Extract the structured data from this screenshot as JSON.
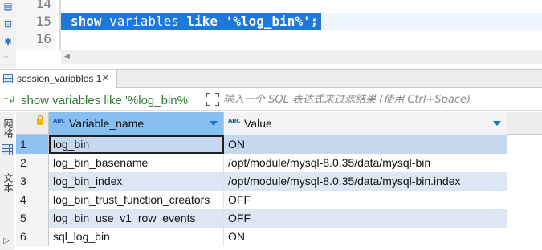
{
  "editor": {
    "line_numbers": [
      "14",
      "15",
      "16"
    ],
    "code_parts": [
      "show",
      " variables ",
      "like",
      " '%log_bin%';"
    ]
  },
  "result_tabs": [
    {
      "label": "session_variables 1",
      "close": "×"
    }
  ],
  "filter": {
    "query_text": "show variables like '%log_bin%'",
    "placeholder": "输入一个 SQL 表达式来过滤结果 (使用 Ctrl+Space)"
  },
  "side_panel": {
    "grid_label": "网格",
    "text_label": "文本"
  },
  "grid": {
    "type_badge": "ABC",
    "columns": [
      {
        "name": "Variable_name"
      },
      {
        "name": "Value"
      }
    ],
    "rows": [
      {
        "num": "1",
        "variable_name": "log_bin",
        "value": "ON"
      },
      {
        "num": "2",
        "variable_name": "log_bin_basename",
        "value": "/opt/module/mysql-8.0.35/data/mysql-bin"
      },
      {
        "num": "3",
        "variable_name": "log_bin_index",
        "value": "/opt/module/mysql-8.0.35/data/mysql-bin.index"
      },
      {
        "num": "4",
        "variable_name": "log_bin_trust_function_creators",
        "value": "OFF"
      },
      {
        "num": "5",
        "variable_name": "log_bin_use_v1_row_events",
        "value": "OFF"
      },
      {
        "num": "6",
        "variable_name": "sql_log_bin",
        "value": "ON"
      }
    ],
    "selected_row": "1"
  },
  "colors": {
    "selection": "#1e78d7",
    "header_active": "#87bff0",
    "row_alt": "#dde7f4",
    "filter_text": "#2e7d32"
  }
}
